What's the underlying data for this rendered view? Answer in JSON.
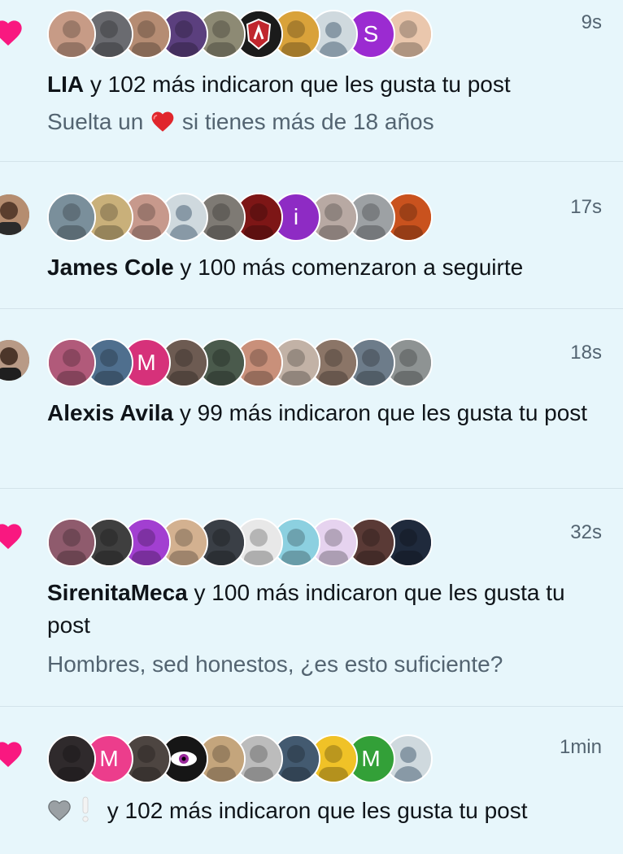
{
  "notifications": [
    {
      "kind": "like",
      "time": "9s",
      "actor": "LIA",
      "action": " y 102 más indicaron que les gusta tu post",
      "post_text_pre": "Suelta un ",
      "post_text_post": " si tienes más de 18 años",
      "avatars": [
        {
          "type": "photo",
          "color": "#c79b86"
        },
        {
          "type": "photo",
          "color": "#6a6b70"
        },
        {
          "type": "photo",
          "color": "#b58c73"
        },
        {
          "type": "photo",
          "color": "#5b3f7e"
        },
        {
          "type": "photo",
          "color": "#8d8a74"
        },
        {
          "type": "logo",
          "color": "#1b1b1b"
        },
        {
          "type": "photo",
          "color": "#d9a23a"
        },
        {
          "type": "default",
          "color": "#cfd9de"
        },
        {
          "type": "letter",
          "letter": "S",
          "color": "#9b2bd1"
        },
        {
          "type": "photo",
          "color": "#eac7ad"
        }
      ]
    },
    {
      "kind": "follow",
      "time": "17s",
      "actor": "James Cole",
      "action": " y 100 más comenzaron a seguirte",
      "avatars": [
        {
          "type": "photo",
          "color": "#7a8f9b"
        },
        {
          "type": "photo",
          "color": "#c9b07a"
        },
        {
          "type": "photo",
          "color": "#c7998c"
        },
        {
          "type": "default",
          "color": "#cfd9de"
        },
        {
          "type": "photo",
          "color": "#7e7a74"
        },
        {
          "type": "photo",
          "color": "#7d1616"
        },
        {
          "type": "letter",
          "letter": "i",
          "color": "#8e2bc4"
        },
        {
          "type": "photo",
          "color": "#b8a9a3"
        },
        {
          "type": "photo",
          "color": "#9da1a4"
        },
        {
          "type": "photo",
          "color": "#c9521e"
        }
      ]
    },
    {
      "kind": "like-profile",
      "time": "18s",
      "actor": "Alexis Avila",
      "action": " y 99 más indicaron que les gusta tu post",
      "avatars": [
        {
          "type": "photo",
          "color": "#b15a7a"
        },
        {
          "type": "photo",
          "color": "#4f6f8e"
        },
        {
          "type": "letter",
          "letter": "M",
          "color": "#d6317a"
        },
        {
          "type": "photo",
          "color": "#6d5b52"
        },
        {
          "type": "photo",
          "color": "#4a5a4c"
        },
        {
          "type": "photo",
          "color": "#c9907a"
        },
        {
          "type": "photo",
          "color": "#c2b2a6"
        },
        {
          "type": "photo",
          "color": "#8b7567"
        },
        {
          "type": "photo",
          "color": "#6d7c8a"
        },
        {
          "type": "photo",
          "color": "#8e9393"
        }
      ]
    },
    {
      "kind": "like",
      "time": "32s",
      "actor": "SirenitaMeca",
      "action": " y 100 más indicaron que les gusta tu post",
      "post_text": "Hombres, sed honestos, ¿es esto suficiente?",
      "avatars": [
        {
          "type": "photo",
          "color": "#8f5b6d"
        },
        {
          "type": "photo",
          "color": "#3f3f3f"
        },
        {
          "type": "photo",
          "color": "#a23fd1"
        },
        {
          "type": "photo",
          "color": "#d3b190"
        },
        {
          "type": "photo",
          "color": "#3a3f46"
        },
        {
          "type": "photo",
          "color": "#e8e8e8"
        },
        {
          "type": "photo",
          "color": "#8cd0e0"
        },
        {
          "type": "photo",
          "color": "#e6d3ef"
        },
        {
          "type": "photo",
          "color": "#5a3a36"
        },
        {
          "type": "photo",
          "color": "#1f2a3c"
        }
      ]
    },
    {
      "kind": "like",
      "time": "1min",
      "actor": "",
      "action": " y 102 más indicaron que les gusta tu post",
      "avatars": [
        {
          "type": "photo",
          "color": "#2f2a2c"
        },
        {
          "type": "letter",
          "letter": "M",
          "color": "#ec3d8c"
        },
        {
          "type": "photo",
          "color": "#4d4541"
        },
        {
          "type": "eye",
          "color": "#161616"
        },
        {
          "type": "photo",
          "color": "#c4a57c"
        },
        {
          "type": "photo",
          "color": "#bcbcbc"
        },
        {
          "type": "photo",
          "color": "#435a70"
        },
        {
          "type": "photo",
          "color": "#f0c227"
        },
        {
          "type": "letter",
          "letter": "M",
          "color": "#33a038"
        },
        {
          "type": "default",
          "color": "#cfd9de"
        }
      ]
    }
  ],
  "colors": {
    "background": "#e7f6fb",
    "heart": "#f91880",
    "secondary_text": "#536471",
    "divider": "#d3e3ea"
  }
}
